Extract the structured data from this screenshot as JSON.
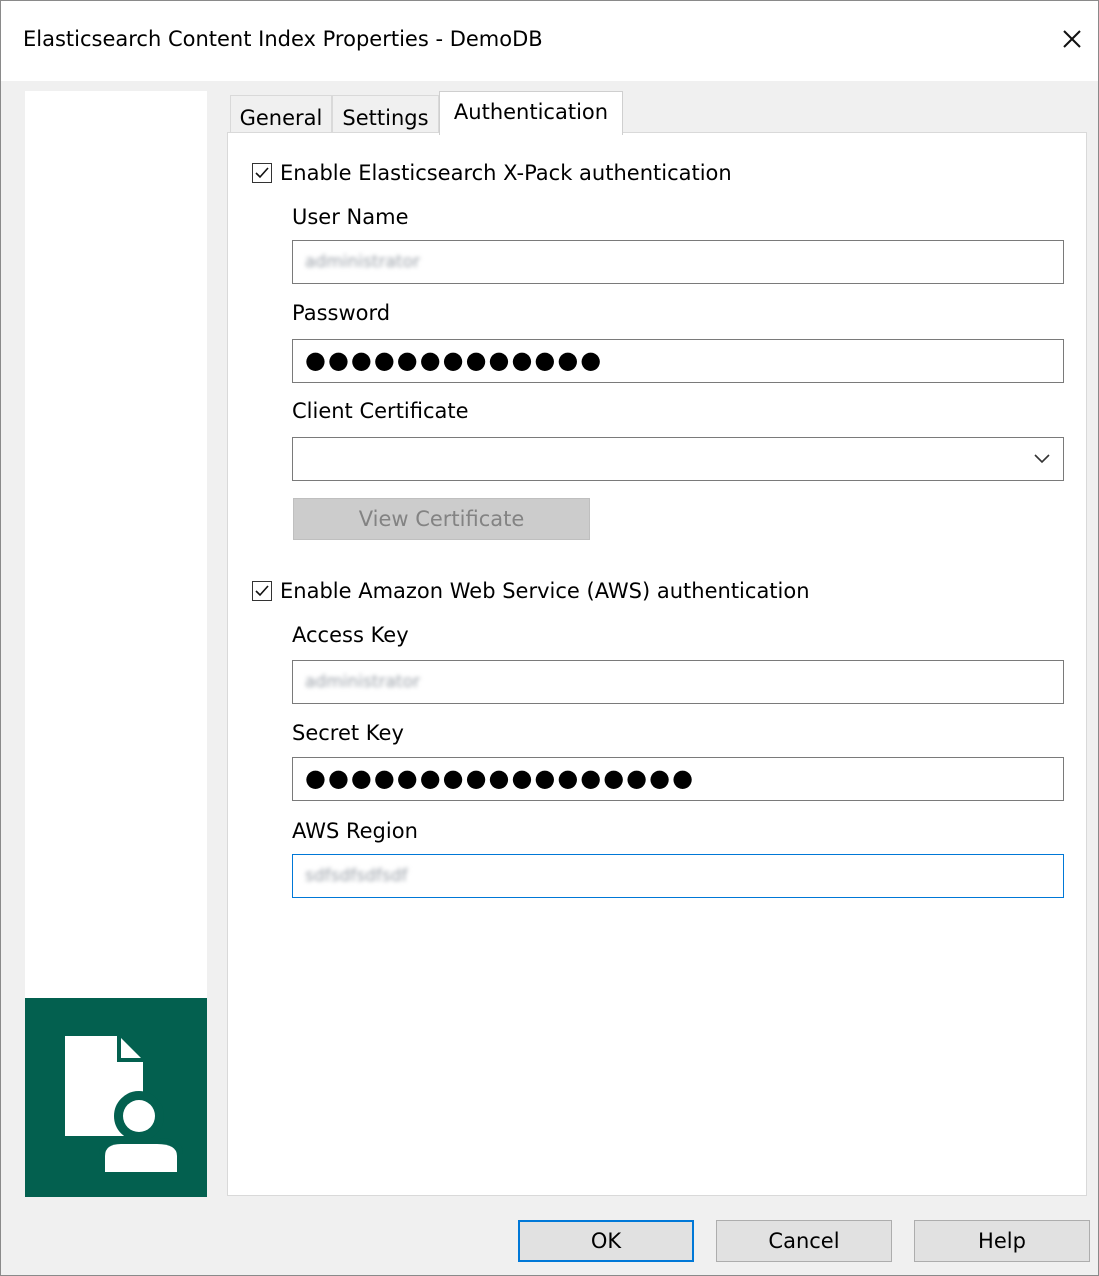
{
  "window": {
    "title": "Elasticsearch Content Index Properties - DemoDB"
  },
  "tabs": [
    {
      "label": "General",
      "active": false
    },
    {
      "label": "Settings",
      "active": false
    },
    {
      "label": "Authentication",
      "active": true
    }
  ],
  "xpack": {
    "enable_label": "Enable Elasticsearch X-Pack authentication",
    "enabled": true,
    "username_label": "User Name",
    "username_value": "administrator",
    "password_label": "Password",
    "password_value": "●●●●●●●●●●●●●",
    "client_cert_label": "Client Certificate",
    "client_cert_value": "",
    "view_cert_label": "View Certificate"
  },
  "aws": {
    "enable_label": "Enable Amazon Web Service (AWS) authentication",
    "enabled": true,
    "access_key_label": "Access Key",
    "access_key_value": "administrator",
    "secret_key_label": "Secret Key",
    "secret_key_value": "●●●●●●●●●●●●●●●●●",
    "region_label": "AWS Region",
    "region_value": "sdfsdfsdfsdf"
  },
  "buttons": {
    "ok": "OK",
    "cancel": "Cancel",
    "help": "Help"
  },
  "colors": {
    "logo_bg": "#03604f",
    "focus": "#0078d7"
  },
  "icons": {
    "close": "close-icon",
    "logo": "document-user-icon",
    "dropdown": "chevron-down-icon",
    "check": "checkmark-icon"
  }
}
